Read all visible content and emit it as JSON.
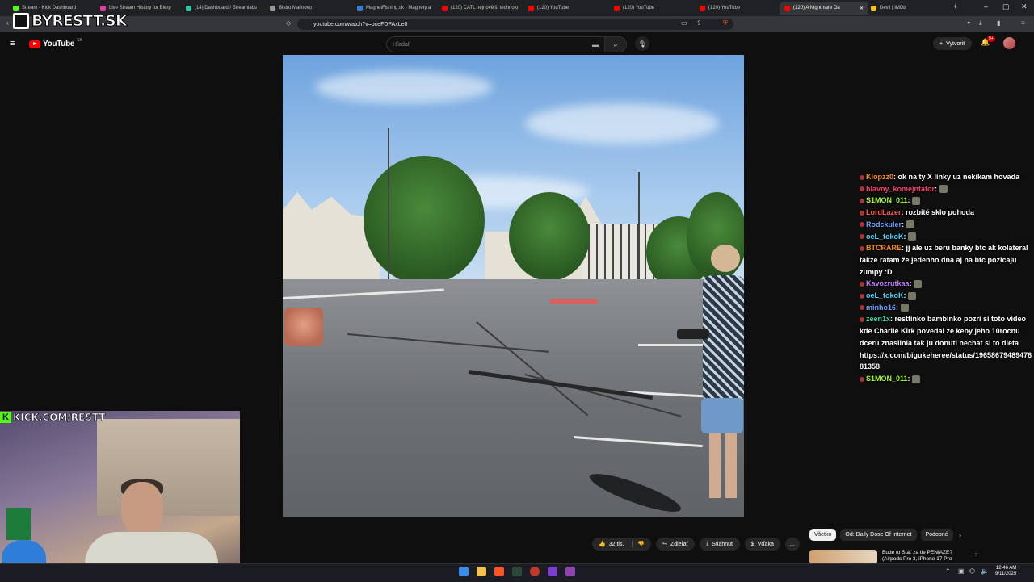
{
  "browser": {
    "tabs": [
      {
        "label": "Stream - Kick Dashboard",
        "color": "#53fc18"
      },
      {
        "label": "Live Stream History for Blerp",
        "color": "#e040a0"
      },
      {
        "label": "(14) Dashboard / Streamlabs",
        "color": "#31c3a2"
      },
      {
        "label": "Bistro Malinovo",
        "color": "#999999"
      },
      {
        "label": "MagnetFishing.sk - Magnety a",
        "color": "#3a7bd5"
      },
      {
        "label": "(120) CATL nejnovější technolo",
        "color": "#ff0000"
      },
      {
        "label": "(120) YouTube",
        "color": "#ff0000"
      },
      {
        "label": "(120) YouTube",
        "color": "#ff0000"
      },
      {
        "label": "(120) YouTube",
        "color": "#ff0000"
      },
      {
        "label": "(120) A Nightmare Da",
        "color": "#ff0000",
        "active": true
      },
      {
        "label": "Devil | IMDb",
        "color": "#f5c518"
      }
    ],
    "url": "youtube.com/watch?v=pceFDPAxLe0"
  },
  "youtube": {
    "logo_text": "YouTube",
    "region": "SK",
    "search_placeholder": "Hľadať",
    "create_label": "Vytvoriť",
    "notifications_badge": "9+",
    "actions": {
      "likes": "32 tis.",
      "share": "Zdieľať",
      "download": "Stiahnuť",
      "thanks": "Vďaka",
      "more": "..."
    },
    "chips": [
      "Všetko",
      "Od: Daily Dose Of Internet",
      "Podobné"
    ],
    "recommendation_title": "Bude to Stáť za tie PENIAZE? (Airpods Pro 3, iPhone 17 Pro"
  },
  "overlay": {
    "brand": "BYRESTT.SK",
    "kick": "KICK.COM/RESTT"
  },
  "chat": [
    {
      "user": "Klopzz0",
      "color": "#ff8c1a",
      "text": "ok na ty X linky uz nekikam hovada",
      "emote": false
    },
    {
      "user": "hlavny_komejntator",
      "color": "#ff3b6b",
      "text": "",
      "emote": true
    },
    {
      "user": "S1MON_011",
      "color": "#a5ff3a",
      "text": "",
      "emote": true
    },
    {
      "user": "LordLazer",
      "color": "#ff5a5a",
      "text": "rozbité sklo pohoda",
      "emote": false
    },
    {
      "user": "Rodckuler",
      "color": "#6fa3ff",
      "text": "",
      "emote": true
    },
    {
      "user": "oeL_tokoK",
      "color": "#4ad8ff",
      "text": "",
      "emote": true
    },
    {
      "user": "BTCRARE",
      "color": "#ff8c1a",
      "text": "jj ale uz beru banky btc ak kolateral takze ratam že jedenho dna aj na btc pozicaju zumpy :D",
      "emote": false
    },
    {
      "user": "Kavozrutkaa",
      "color": "#c17bff",
      "text": "",
      "emote": true
    },
    {
      "user": "oeL_tokoK",
      "color": "#4ad8ff",
      "text": "",
      "emote": true
    },
    {
      "user": "minho16",
      "color": "#6fa3ff",
      "text": "",
      "emote": true
    },
    {
      "user": "zeen1x",
      "color": "#3ad8a0",
      "text": "resttinko bambinko pozri si toto video kde Charlie Kirk povedal ze keby jeho 10rocnu dceru znasilnia tak ju donuti nechat si to dieta https://x.com/bigukeheree/status/1965867948947681358",
      "emote": false
    },
    {
      "user": "S1MON_011",
      "color": "#a5ff3a",
      "text": "",
      "emote": true
    }
  ],
  "taskbar": {
    "time": "12:46 AM",
    "date": "9/11/2025"
  }
}
